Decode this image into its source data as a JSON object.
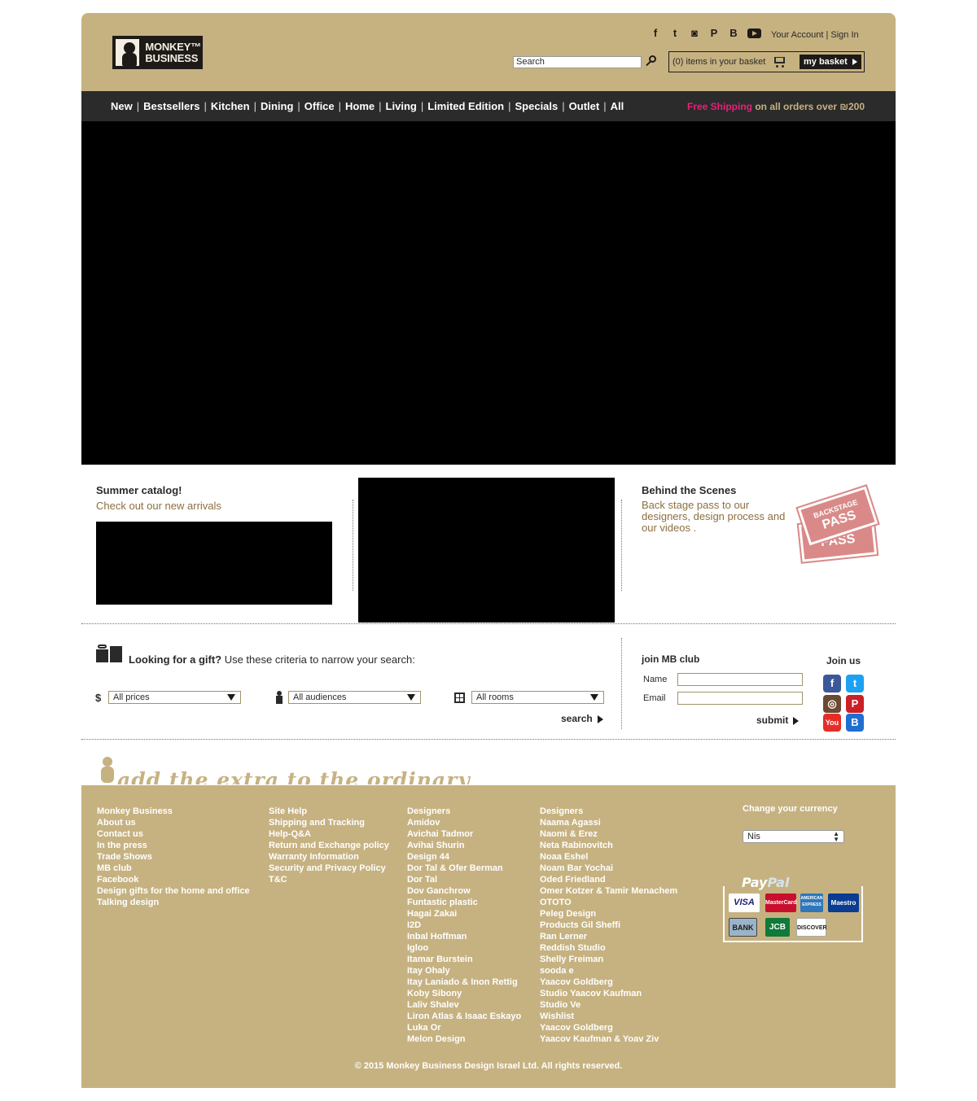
{
  "header": {
    "logo_line1": "MONKEY™",
    "logo_line2": "BUSINESS",
    "social": [
      "facebook-icon",
      "twitter-icon",
      "instagram-icon",
      "pinterest-icon",
      "b-icon",
      "youtube-icon"
    ],
    "account_link": "Your Account",
    "account_sep": "|",
    "signin_link": "Sign In",
    "search_placeholder": "Search",
    "basket_count": "(0) items in your basket",
    "basket_button": "my basket"
  },
  "nav": {
    "items": [
      "New",
      "Bestsellers",
      "Kitchen",
      "Dining",
      "Office",
      "Home",
      "Living",
      "Limited Edition",
      "Specials",
      "Outlet",
      "All"
    ],
    "separator": "|",
    "free_shipping_highlight": "Free Shipping",
    "free_shipping_rest": " on all orders over ₪200"
  },
  "promos": {
    "left_title": "Summer catalog!",
    "left_subtitle": "Check out our new arrivals",
    "right_title": "Behind the Scenes",
    "right_subtitle": "Back stage pass to our designers, design process and our videos .",
    "ticket_top_small": "BACKSTAGE",
    "ticket_top_big": "PASS",
    "ticket_bottom_big": "PASS"
  },
  "gift_finder": {
    "heading_bold": "Looking for a gift?",
    "heading_rest": " Use these criteria to narrow your search:",
    "price_icon": "$",
    "price_value": "All prices",
    "audience_value": "All audiences",
    "room_value": "All rooms",
    "search_label": "search"
  },
  "club": {
    "title": "join MB club",
    "name_label": "Name",
    "email_label": "Email",
    "submit_label": "submit",
    "join_us": "Join us",
    "icons": {
      "facebook": "f",
      "twitter": "t",
      "instagram": "◎",
      "pinterest": "P",
      "youtube": "You",
      "b": "B"
    },
    "colors": {
      "facebook": "#3b5998",
      "twitter": "#1da1f2",
      "instagram": "#6b4a33",
      "pinterest": "#cb2027",
      "youtube": "#e52d27",
      "b": "#1f6fd1"
    }
  },
  "tagline": "add the extra to the ordinary",
  "footer": {
    "col1": {
      "heading": "Monkey Business",
      "links": [
        "About us",
        "Contact us",
        "In the press",
        "Trade Shows",
        "MB club",
        "Facebook",
        "Design gifts for the home and office",
        "Talking design"
      ]
    },
    "col2": {
      "heading": "Site Help",
      "links": [
        "Shipping and Tracking",
        "Help-Q&A",
        "Return and Exchange policy",
        "Warranty Information",
        "Security and Privacy Policy",
        "T&C"
      ]
    },
    "col3": {
      "heading": "Designers",
      "links": [
        "Amidov",
        "Avichai Tadmor",
        "Avihai Shurin",
        "Design 44",
        "Dor Tal & Ofer Berman",
        "Dor Tal",
        "Dov Ganchrow",
        "Funtastic plastic",
        "Hagai Zakai",
        "I2D",
        "Inbal Hoffman",
        "Igloo",
        "Itamar Burstein",
        "Itay Ohaly",
        "Itay Laniado & Inon Rettig",
        "Koby Sibony",
        "Laliv Shalev",
        "Liron Atlas & Isaac Eskayo",
        "Luka Or",
        "Melon Design"
      ]
    },
    "col4": {
      "heading": "Designers",
      "links": [
        "Naama Agassi",
        "Naomi & Erez",
        "Neta Rabinovitch",
        "Noaa Eshel",
        "Noam Bar Yochai",
        "Oded Friedland",
        "Omer Kotzer & Tamir Menachem",
        "OTOTO",
        "Peleg Design",
        "Products Gil Sheffi",
        "Ran Lerner",
        "Reddish Studio",
        "Shelly Freiman",
        "sooda e",
        "Yaacov Goldberg",
        "Studio Yaacov Kaufman",
        "Studio Ve",
        "Wishlist",
        "Yaacov Goldberg",
        "Yaacov Kaufman & Yoav Ziv"
      ]
    },
    "currency_label": "Change your currency",
    "currency_value": "Nis",
    "paypal_a": "Pay",
    "paypal_b": "Pal",
    "cards": [
      "VISA",
      "MasterCard",
      "AMERICAN EXPRESS",
      "Maestro",
      "BANK",
      "JCB",
      "DISCOVER"
    ],
    "copyright": "© 2015 Monkey Business Design Israel Ltd. All rights reserved."
  }
}
